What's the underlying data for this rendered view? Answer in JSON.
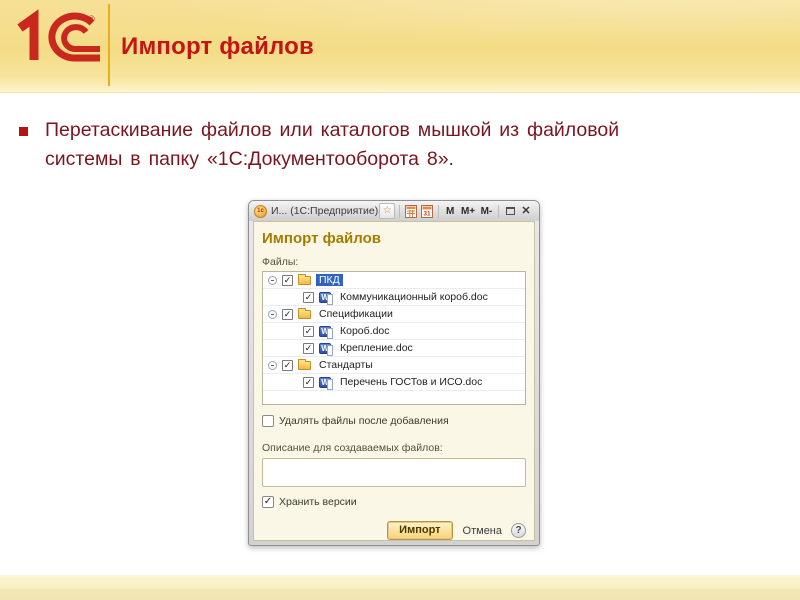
{
  "header": {
    "logo_text": "1С",
    "logo_registered": "®",
    "title": "Импорт файлов"
  },
  "bullet": {
    "lines": [
      "Перетаскивание файлов или каталогов мышкой из файловой",
      "системы в папку «1С:Документооборота 8»."
    ]
  },
  "dialog": {
    "titlebar": {
      "title": "И... (1С:Предприятие)",
      "app_icon": "1с",
      "star_glyph": "☆",
      "memory_buttons": [
        "M",
        "M+",
        "M-"
      ],
      "close_glyph": "✕"
    },
    "heading": "Импорт файлов",
    "files_label": "Файлы:",
    "tree": {
      "rows": [
        {
          "type": "folder",
          "indent": 0,
          "label": "ПКД",
          "checked": true,
          "expanded": true,
          "selected": true
        },
        {
          "type": "file",
          "indent": 1,
          "label": "Коммуникационный короб.doc",
          "checked": true
        },
        {
          "type": "folder",
          "indent": 0,
          "label": "Спецификации",
          "checked": true,
          "expanded": true
        },
        {
          "type": "file",
          "indent": 1,
          "label": "Короб.doc",
          "checked": true
        },
        {
          "type": "file",
          "indent": 1,
          "label": "Крепление.doc",
          "checked": true
        },
        {
          "type": "folder",
          "indent": 0,
          "label": "Стандарты",
          "checked": true,
          "expanded": true
        },
        {
          "type": "file",
          "indent": 1,
          "label": "Перечень ГОСТов и ИСО.doc",
          "checked": true
        }
      ]
    },
    "delete_after_checkbox": {
      "label": "Удалять файлы после добавления",
      "checked": false
    },
    "description_label": "Описание для создаваемых файлов:",
    "description_value": "",
    "keep_versions_checkbox": {
      "label": "Хранить версии",
      "checked": true
    },
    "footer_buttons": {
      "import": "Импорт",
      "cancel": "Отмена",
      "help": "?"
    }
  },
  "colors": {
    "header_title": "#C41414",
    "bullet_text": "#7A1520",
    "selection": "#2F63BE",
    "dialog_heading": "#A67C00",
    "import_button": "#F7D179"
  }
}
